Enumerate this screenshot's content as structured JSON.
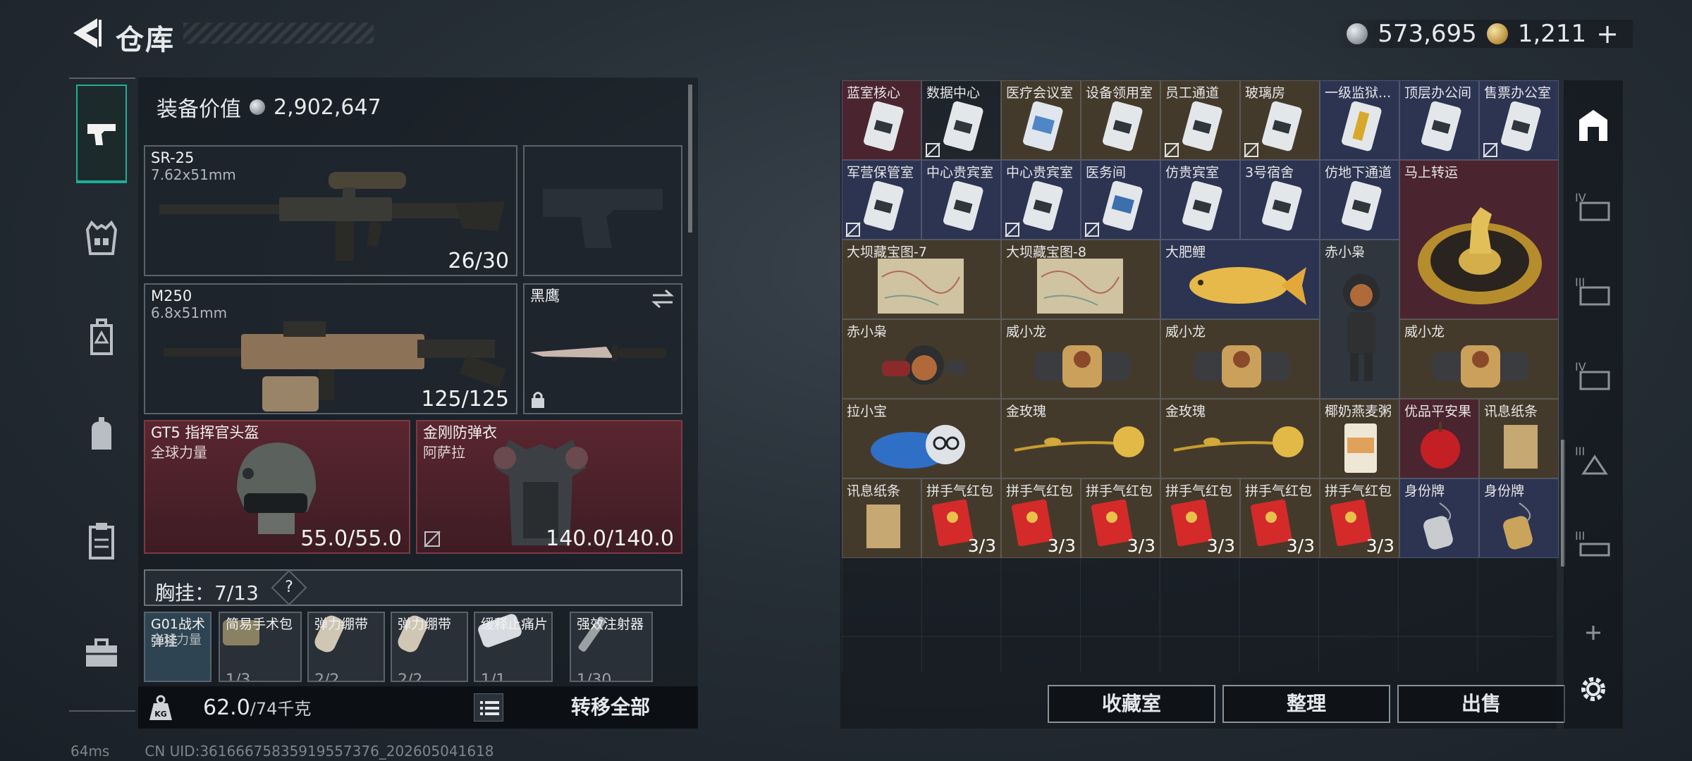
{
  "header": {
    "title": "仓库",
    "silver": "573,695",
    "gold": "1,211",
    "add": "+"
  },
  "left": {
    "equipment_value_label": "装备价值",
    "equipment_value": "2,902,647",
    "primary": {
      "name": "SR-25",
      "caliber": "7.62x51mm",
      "ammo": "26/30"
    },
    "secondary": {
      "name": "M250",
      "caliber": "6.8x51mm",
      "ammo": "125/125"
    },
    "melee": {
      "name": "黑鹰"
    },
    "helmet": {
      "name": "GT5 指挥官头盔",
      "sub": "全球力量",
      "durability": "55.0/55.0"
    },
    "armor": {
      "name": "金刚防弹衣",
      "sub": "阿萨拉",
      "durability": "140.0/140.0"
    },
    "chest_rig": {
      "label": "胸挂：",
      "value": "7/13",
      "help": "?"
    },
    "rig_items": [
      {
        "name": "G01战术弹挂",
        "sub": "全球力量"
      },
      {
        "name": "简易手术包",
        "sub": "",
        "count": "1/3"
      },
      {
        "name": "弹力绷带",
        "sub": "",
        "count": "2/2"
      },
      {
        "name": "弹力绷带",
        "sub": "",
        "count": "2/2"
      },
      {
        "name": "缓释止痛片",
        "sub": "",
        "count": "1/1"
      },
      {
        "name": "强效注射器",
        "sub": "",
        "count": "1/30"
      }
    ],
    "weight": "62.0",
    "weight_max": "/74千克",
    "transfer_all": "转移全部"
  },
  "stash": {
    "row1": [
      "蓝室核心",
      "数据中心",
      "医疗会议室",
      "设备领用室",
      "员工通道",
      "玻璃房",
      "一级监狱...",
      "顶层办公间",
      "售票办公室"
    ],
    "row2": [
      "军营保管室",
      "中心贵宾室",
      "中心贵宾室",
      "医务间",
      "仿贵宾室",
      "3号宿舍",
      "仿地下通道"
    ],
    "big_gold": "马上转运",
    "maps": [
      "大坝藏宝图-7",
      "大坝藏宝图-8"
    ],
    "fish": "大肥鲤",
    "figure_stand": "赤小枭",
    "row4": [
      "赤小枭",
      "威小龙",
      "威小龙",
      "威小龙"
    ],
    "row5": [
      "拉小宝",
      "金玫瑰",
      "金玫瑰",
      "椰奶燕麦粥",
      "优品平安果",
      "讯息纸条"
    ],
    "row6_note": "讯息纸条",
    "red_packet": "拼手气红包",
    "red_count": "3/3",
    "dogtags": [
      "身份牌",
      "身份牌"
    ],
    "buttons": {
      "collection": "收藏室",
      "sort": "整理",
      "sell": "出售"
    }
  },
  "status": {
    "ping": "64ms",
    "uid": "CN UID:3616667583591955737​6_202605041618"
  },
  "colors": {
    "accent": "#1fae95",
    "rarity_red": "#4a2530",
    "rarity_blue": "#2c3452",
    "rarity_gold": "#443a2c"
  }
}
